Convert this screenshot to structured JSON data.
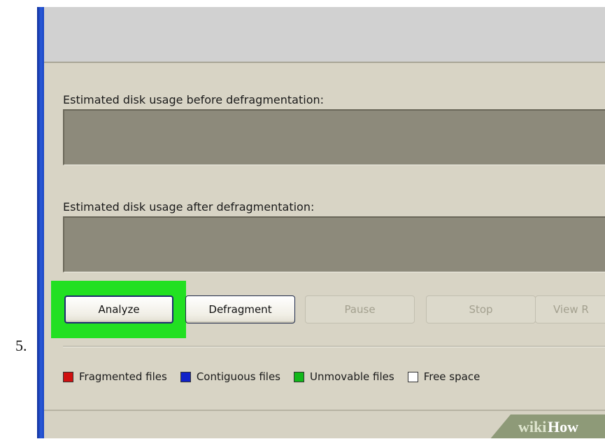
{
  "step": {
    "number": "5."
  },
  "window": {
    "usage_before_label": "Estimated disk usage before defragmentation:",
    "usage_after_label": "Estimated disk usage after defragmentation:"
  },
  "buttons": {
    "analyze": "Analyze",
    "defragment": "Defragment",
    "pause": "Pause",
    "stop": "Stop",
    "view_report": "View R"
  },
  "legend": [
    {
      "label": "Fragmented files",
      "color": "#d01010"
    },
    {
      "label": "Contiguous files",
      "color": "#1022c8"
    },
    {
      "label": "Unmovable files",
      "color": "#12b81a"
    },
    {
      "label": "Free space",
      "color": "#ffffff"
    }
  ],
  "colors": {
    "highlight": "#22e022",
    "window_bg": "#d8d4c5",
    "usage_bar": "#8d8a7b"
  },
  "watermark": {
    "text_wiki": "wiki",
    "text_how": "How"
  }
}
